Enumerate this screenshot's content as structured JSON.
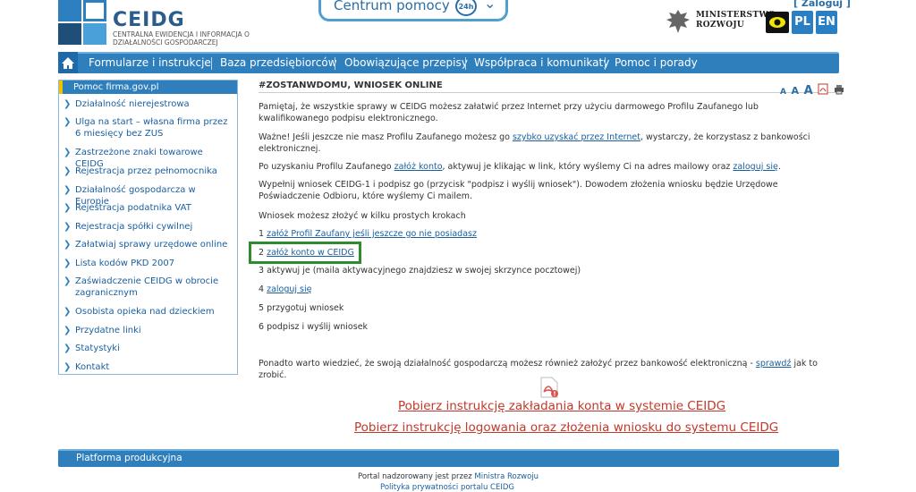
{
  "header": {
    "logo_name": "CEIDG",
    "logo_sub": "CENTRALNA EWIDENCJA I INFORMACJA O DZIAŁALNOŚCI GOSPODARCZEJ",
    "help": "Centrum pomocy",
    "help_badge": "24h",
    "login": "[ Zaloguj ]",
    "ministry": [
      "MINISTERSTWO",
      "ROZWOJU"
    ],
    "lang_pl": "PL",
    "lang_en": "EN"
  },
  "nav": {
    "items": [
      "Formularze i instrukcje",
      "Baza przedsiębiorców",
      "Obowiązujące przepisy",
      "Współpraca i komunikaty",
      "Pomoc i porady"
    ]
  },
  "sidebar": {
    "title": "Pomoc firma.gov.pl",
    "items": [
      "Działalność nierejestrowa",
      "Ulga na start – własna firma przez 6 miesięcy bez ZUS",
      "Zastrzeżone znaki towarowe CEIDG",
      "Rejestracja przez pełnomocnika",
      "Działalność gospodarcza w Europie",
      "Rejestracja podatnika VAT",
      "Rejestracja spółki cywilnej",
      "Załatwiaj sprawy urzędowe online",
      "Lista kodów PKD 2007",
      "Zaświadczenie CEIDG w obrocie zagranicznym",
      "Osobista opieka nad dzieckiem",
      "Przydatne linki",
      "Statystyki",
      "Kontakt"
    ]
  },
  "content": {
    "title": "#ZOSTANWDOMU, WNIOSEK ONLINE",
    "tools": [
      "A",
      "A",
      "A"
    ],
    "p1": "Pamiętaj, że wszystkie sprawy w CEIDG możesz załatwić przez Internet przy użyciu darmowego Profilu Zaufanego lub kwalifikowanego podpisu elektronicznego.",
    "p2_pre": "Ważne! Jeśli jeszcze nie masz Profilu Zaufanego możesz go ",
    "p2_link": "szybko uzyskać przez Internet",
    "p2_post": ", wystarczy, że korzystasz z bankowości elektronicznej.",
    "p3_pre": "Po uzyskaniu Profilu Zaufanego ",
    "p3_link1": "załóż konto",
    "p3_mid": ", aktywuj je klikając w link, który wyślemy Ci na adres mailowy oraz ",
    "p3_link2": "zaloguj się",
    "p3_post": ".",
    "p4": "Wypełnij wniosek CEIDG-1 i podpisz go (przycisk \"podpisz i wyślij wniosek\"). Dowodem złożenia wniosku będzie Urzędowe Poświadczenie Odbioru, które wyślemy Ci mailem.",
    "p5": "Wniosek możesz złożyć w kilku prostych krokach",
    "s1_num": "1 ",
    "s1_link": "załóż Profil Zaufany jeśli jeszcze go nie posiadasz",
    "s2_num": "2 ",
    "s2_link": "załóż konto w CEIDG",
    "s3": "3 aktywuj je (maila aktywacyjnego znajdziesz w swojej skrzynce pocztowej)",
    "s4_num": "4 ",
    "s4_link": "zaloguj się",
    "s5": "5 przygotuj wniosek",
    "s6": "6 podpisz i wyślij wniosek",
    "p6_pre": "Ponadto warto wiedzieć, że swoją działalność gospodarczą możesz również założyć przez bankowość elektroniczną - ",
    "p6_link": "sprawdź",
    "p6_post": " jak to zrobić.",
    "link_big1": "Pobierz instrukcję zakładania konta w systemie CEIDG",
    "link_big2": "Pobierz instrukcję logowania oraz złożenia wniosku do systemu CEIDG"
  },
  "footer": {
    "bar": "Platforma produkcyjna",
    "line1_pre": "Portal nadzorowany jest przez ",
    "line1_link": "Ministra Rozwoju",
    "line2_link": "Polityka prywatności portalu CEIDG"
  },
  "colors": {
    "nav": "#2f7fbd",
    "highlight": "#2e8b2e",
    "link_red": "#c0392b"
  }
}
